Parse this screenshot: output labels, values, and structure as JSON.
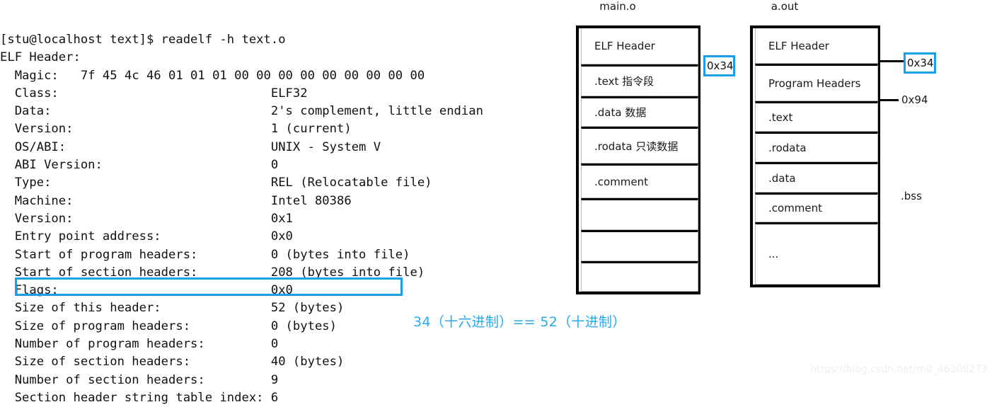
{
  "terminal": {
    "lines": [
      "[stu@localhost text]$ readelf -h text.o",
      "ELF Header:",
      "  Magic:   7f 45 4c 46 01 01 01 00 00 00 00 00 00 00 00 00",
      "  Class:                             ELF32",
      "  Data:                              2's complement, little endian",
      "  Version:                           1 (current)",
      "  OS/ABI:                            UNIX - System V",
      "  ABI Version:                       0",
      "  Type:                              REL (Relocatable file)",
      "  Machine:                           Intel 80386",
      "  Version:                           0x1",
      "  Entry point address:               0x0",
      "  Start of program headers:          0 (bytes into file)",
      "  Start of section headers:          208 (bytes into file)",
      "  Flags:                             0x0",
      "  Size of this header:               52 (bytes)",
      "  Size of program headers:           0 (bytes)",
      "  Number of program headers:         0",
      "  Size of section headers:           40 (bytes)",
      "  Number of section headers:         9",
      "  Section header string table index: 6"
    ],
    "highlighted_line_index": 15,
    "highlight_color": "#17a0e8"
  },
  "annotation": {
    "text": "34（十六进制）== 52（十进制）",
    "color": "#29a8e8"
  },
  "diagrams": [
    {
      "id": "main-o",
      "title": "main.o",
      "segments": [
        {
          "label": "ELF Header"
        },
        {
          "label": ".text 指令段"
        },
        {
          "label": ".data  数据"
        },
        {
          "label": ".rodata 只读数据"
        },
        {
          "label": ".comment"
        },
        {
          "label": ""
        },
        {
          "label": ""
        },
        {
          "label": ""
        }
      ],
      "address_labels": [
        {
          "text": "0x34",
          "boxed": true
        }
      ]
    },
    {
      "id": "a-out",
      "title": "a.out",
      "segments": [
        {
          "label": "ELF Header"
        },
        {
          "label": "Program Headers"
        },
        {
          "label": ".text"
        },
        {
          "label": ".rodata"
        },
        {
          "label": ".data"
        },
        {
          "label": ".comment"
        },
        {
          "label": "..."
        }
      ],
      "address_labels": [
        {
          "text": "0x34",
          "boxed": true
        },
        {
          "text": "0x94",
          "boxed": false
        }
      ],
      "side_labels": [
        {
          "text": ".bss"
        }
      ]
    }
  ],
  "watermark": {
    "text": "https://blog.csdn.net/m0_46308273"
  }
}
